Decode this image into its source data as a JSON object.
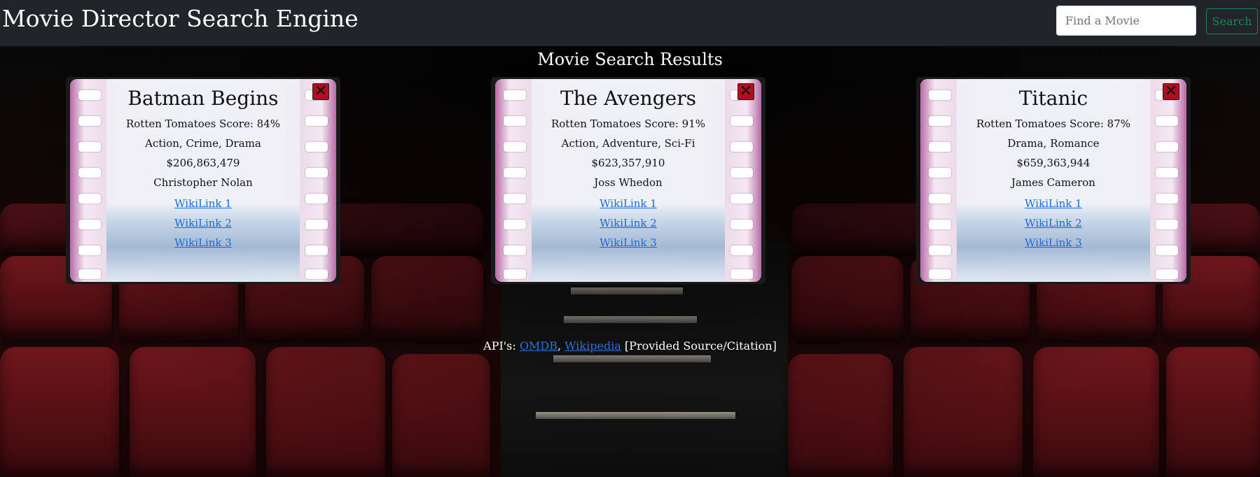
{
  "navbar": {
    "brand": "Movie Director Search Engine",
    "search_placeholder": "Find a Movie",
    "search_button": "Search"
  },
  "results_title": "Movie Search Results",
  "close_glyph": "✕",
  "movies": [
    {
      "title": "Batman Begins",
      "score": "Rotten Tomatoes Score: 84%",
      "genres": "Action, Crime, Drama",
      "box_office": "$206,863,479",
      "director": "Christopher Nolan",
      "links": [
        "WikiLink 1",
        "WikiLink 2",
        "WikiLink 3"
      ]
    },
    {
      "title": "The Avengers",
      "score": "Rotten Tomatoes Score: 91%",
      "genres": "Action, Adventure, Sci-Fi",
      "box_office": "$623,357,910",
      "director": "Joss Whedon",
      "links": [
        "WikiLink 1",
        "WikiLink 2",
        "WikiLink 3"
      ]
    },
    {
      "title": "Titanic",
      "score": "Rotten Tomatoes Score: 87%",
      "genres": "Drama, Romance",
      "box_office": "$659,363,944",
      "director": "James Cameron",
      "links": [
        "WikiLink 1",
        "WikiLink 2",
        "WikiLink 3"
      ]
    }
  ],
  "footer": {
    "prefix": "API's: ",
    "omdb": "OMDB",
    "separator": ", ",
    "wikipedia": "Wikipedia",
    "suffix": " [Provided Source/Citation]"
  },
  "colors": {
    "navbar_bg": "#212529",
    "search_accent": "#198754",
    "link": "#1a6ad9",
    "close_bg": "#b00f1f"
  }
}
